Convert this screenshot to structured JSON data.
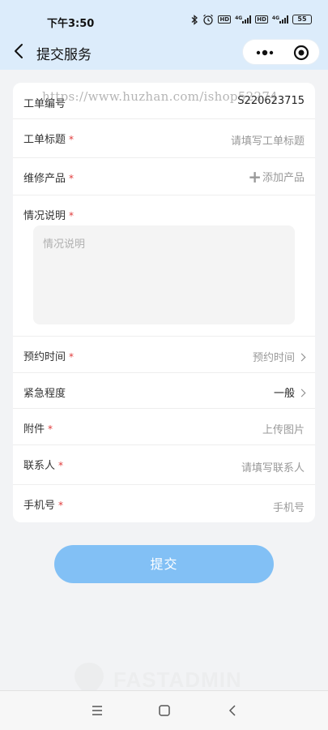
{
  "status_bar": {
    "time": "下午3:50",
    "network_1": "4G",
    "network_2": "4G",
    "hd_1": "HD",
    "hd_2": "HD",
    "battery": "55"
  },
  "nav": {
    "title": "提交服务"
  },
  "watermark_text": "https://www.huzhan.com/ishop52274",
  "form": {
    "ticket_no": {
      "label": "工单编号",
      "value": "S220623715"
    },
    "ticket_title": {
      "label": "工单标题",
      "required": "*",
      "placeholder": "请填写工单标题"
    },
    "repair_product": {
      "label": "维修产品",
      "required": "*",
      "action_plus": "+",
      "action": "添加产品"
    },
    "description": {
      "label": "情况说明",
      "required": "*",
      "placeholder": "情况说明"
    },
    "appointment_time": {
      "label": "预约时间",
      "required": "*",
      "placeholder": "预约时间"
    },
    "urgency": {
      "label": "紧急程度",
      "value": "一般"
    },
    "attachment": {
      "label": "附件",
      "required": "*",
      "action": "上传图片"
    },
    "contact": {
      "label": "联系人",
      "required": "*",
      "placeholder": "请填写联系人"
    },
    "phone": {
      "label": "手机号",
      "required": "*",
      "placeholder": "手机号"
    }
  },
  "submit_label": "提交",
  "brand_watermark": "FASTADMIN",
  "colors": {
    "accent": "#82c0f5",
    "header_bg": "#dcecfb",
    "required": "#e03b3b",
    "add_product": "#f0941f"
  }
}
